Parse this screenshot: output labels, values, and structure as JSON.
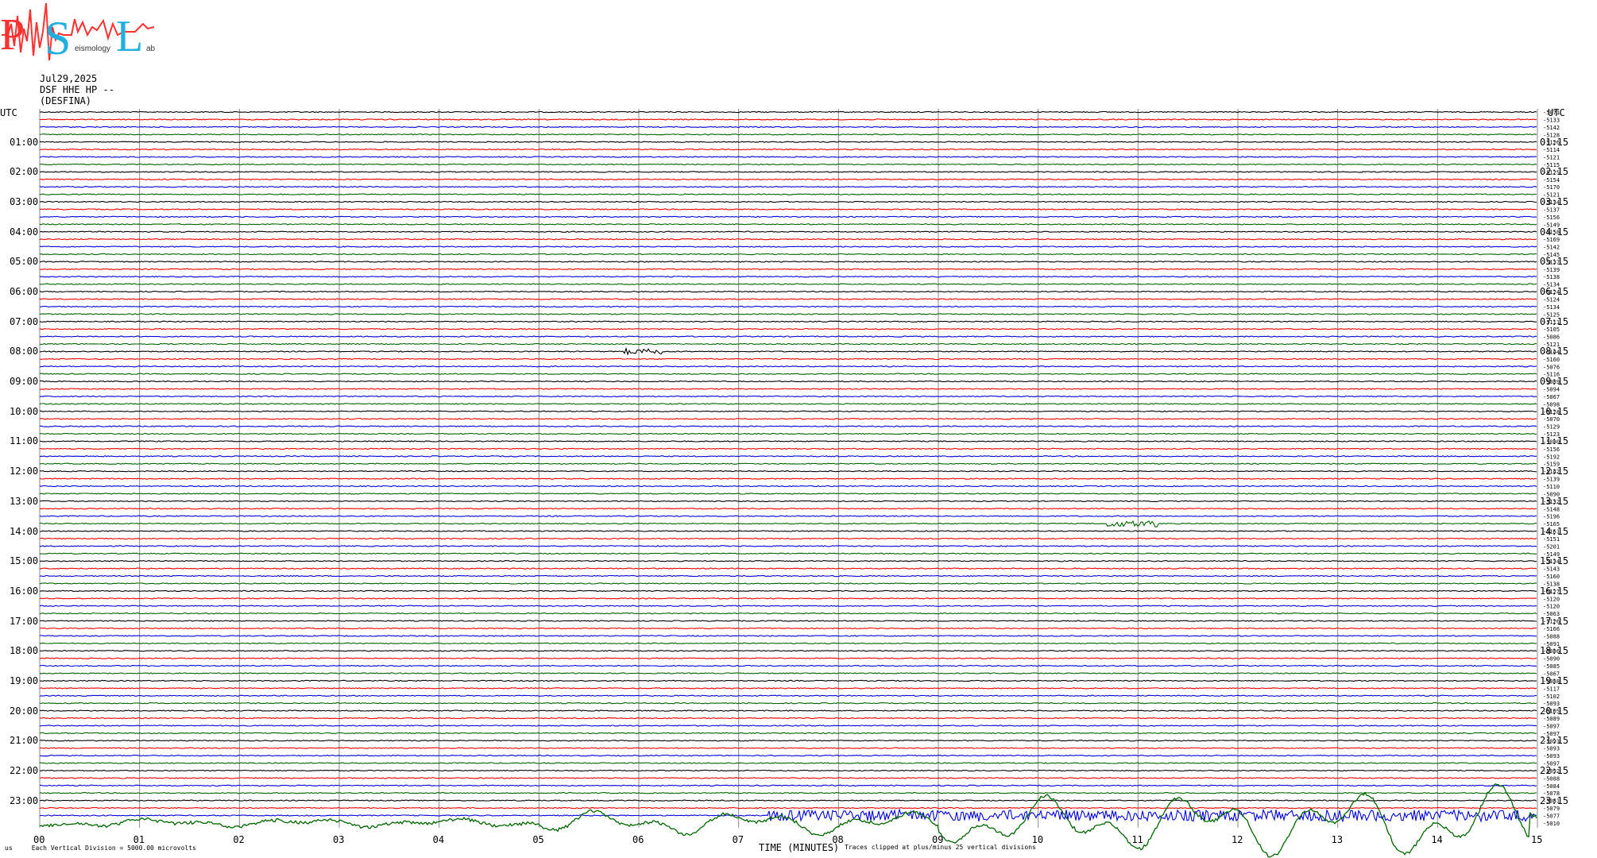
{
  "logo": {
    "letters": [
      "P",
      "S",
      "L"
    ],
    "word_mid": "eismology",
    "word_end": "ab"
  },
  "header": {
    "date": "Jul29,2025",
    "channel": "DSF HHE HP --",
    "station": "(DESFINA)"
  },
  "colors": {
    "black": "#000000",
    "red": "#ee0000",
    "blue": "#0000dd",
    "green": "#006400",
    "grid": "#888888",
    "logo_red": "#ff3030",
    "logo_cyan": "#20b0e0"
  },
  "chart_data": {
    "type": "line",
    "title": "",
    "xlabel": "TIME (MINUTES)",
    "ylabel": "UTC",
    "ylabel_right": "UTC",
    "xlim": [
      0,
      15
    ],
    "x_ticks": [
      "00",
      "01",
      "02",
      "03",
      "04",
      "05",
      "06",
      "07",
      "08",
      "09",
      "10",
      "11",
      "12",
      "13",
      "14",
      "15"
    ],
    "left_hours": [
      "01:00",
      "02:00",
      "03:00",
      "04:00",
      "05:00",
      "06:00",
      "07:00",
      "08:00",
      "09:00",
      "10:00",
      "11:00",
      "12:00",
      "13:00",
      "14:00",
      "15:00",
      "16:00",
      "17:00",
      "18:00",
      "19:00",
      "20:00",
      "21:00",
      "22:00",
      "23:00"
    ],
    "right_hours": [
      "01:15",
      "02:15",
      "03:15",
      "04:15",
      "05:15",
      "06:15",
      "07:15",
      "08:15",
      "09:15",
      "10:15",
      "11:15",
      "12:15",
      "13:15",
      "14:15",
      "15:15",
      "16:15",
      "17:15",
      "18:15",
      "19:15",
      "20:15",
      "21:15",
      "22:15",
      "23:15"
    ],
    "trace_color_cycle": [
      "black",
      "red",
      "blue",
      "green"
    ],
    "trace_offsets": [
      "-5071",
      "-5133",
      "-5142",
      "-5128",
      "-5126",
      "-5114",
      "-5121",
      "-5115",
      "-5125",
      "-5154",
      "-5170",
      "-5121",
      "-5134",
      "-5137",
      "-5156",
      "-5149",
      "-5158",
      "-5169",
      "-5142",
      "-5145",
      "-5137",
      "-5139",
      "-5138",
      "-5134",
      "-5124",
      "-5124",
      "-5134",
      "-5125",
      "-5111",
      "-5105",
      "-5086",
      "-5121",
      "-5144",
      "-5160",
      "-5076",
      "-5116",
      "-5089",
      "-5094",
      "-5067",
      "-5098",
      "-5128",
      "-5070",
      "-5129",
      "-5123",
      "-5080",
      "-5156",
      "-5192",
      "-5159",
      "-5142",
      "-5139",
      "-5110",
      "-5090",
      "-5132",
      "-5148",
      "-5196",
      "-5165",
      "-5161",
      "-5151",
      "-5201",
      "-5149",
      "-5134",
      "-5143",
      "-5160",
      "-5138",
      "-5127",
      "-5120",
      "-5120",
      "-5063",
      "-5126",
      "-5166",
      "-5088",
      "-5091",
      "-5086",
      "-5090",
      "-5085",
      "-5067",
      "-5088",
      "-5117",
      "-5102",
      "-5093",
      "-5105",
      "-5089",
      "-5097",
      "-5097",
      "-5093",
      "-5093",
      "-5093",
      "-5097",
      "-5092",
      "-5088",
      "-5084",
      "-5078",
      "-5081",
      "-5079",
      "-5077",
      "-5010"
    ],
    "events": [
      {
        "trace": 32,
        "minute_start": 5.85,
        "minute_end": 6.25
      },
      {
        "trace": 55,
        "minute_start": 10.65,
        "minute_end": 11.2
      }
    ],
    "footer_left": "Each Vertical Division = 5000.00 microvolts",
    "footer_right": "Traces clipped at plus/minus 25 vertical divisions",
    "corner_mark": "us"
  }
}
